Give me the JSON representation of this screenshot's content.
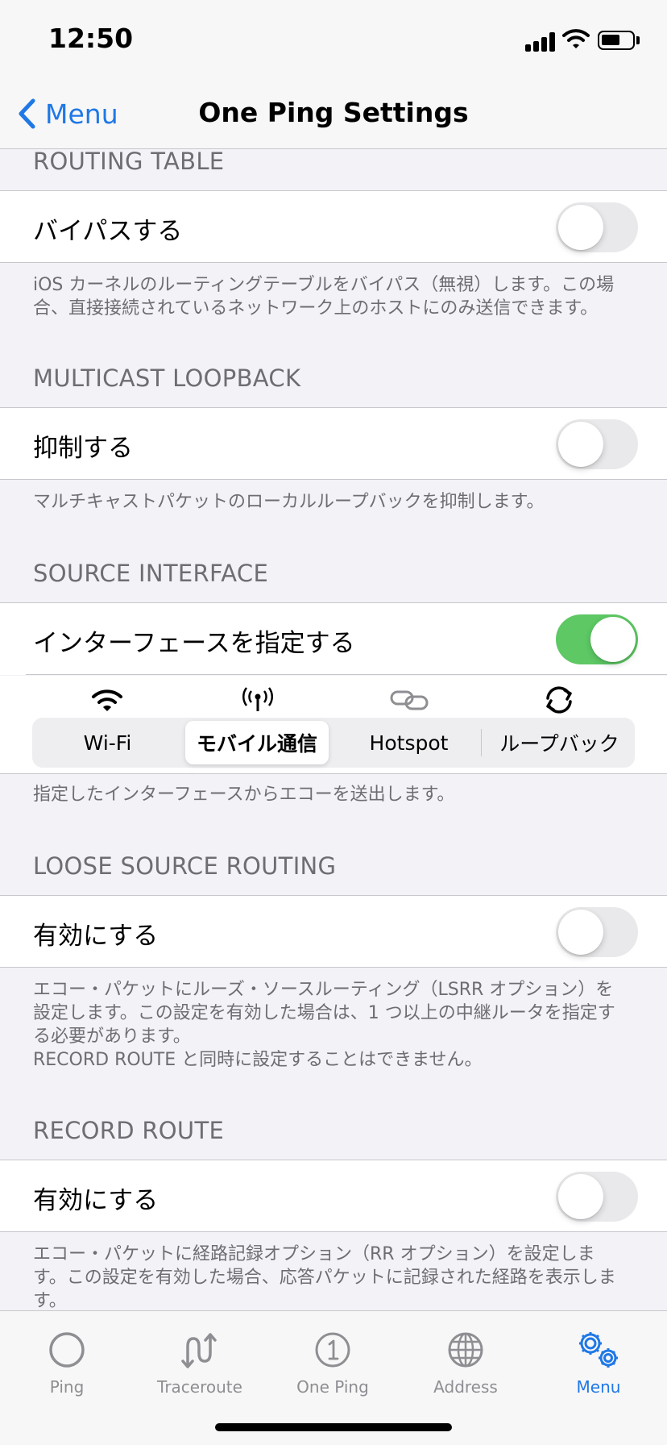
{
  "status_bar": {
    "time": "12:50"
  },
  "nav": {
    "back_label": "Menu",
    "title": "One Ping Settings"
  },
  "routing_table": {
    "header": "ROUTING TABLE",
    "cell_label": "バイパスする",
    "toggle_on": false,
    "footer": "iOS カーネルのルーティングテーブルをバイパス（無視）します。この場\n合、直接接続されているネットワーク上のホストにのみ送信できます。"
  },
  "multicast_loopback": {
    "header": "MULTICAST LOOPBACK",
    "cell_label": "抑制する",
    "toggle_on": false,
    "footer": "マルチキャストパケットのローカルループバックを抑制します。"
  },
  "source_interface": {
    "header": "SOURCE INTERFACE",
    "cell_label": "インターフェースを指定する",
    "toggle_on": true,
    "options": [
      {
        "label": "Wi-Fi",
        "icon": "wifi-icon"
      },
      {
        "label": "モバイル通信",
        "icon": "antenna-icon"
      },
      {
        "label": "Hotspot",
        "icon": "link-icon"
      },
      {
        "label": "ループバック",
        "icon": "loop-icon"
      }
    ],
    "selected_option": "モバイル通信",
    "footer": "指定したインターフェースからエコーを送出します。"
  },
  "loose_source_routing": {
    "header": "LOOSE SOURCE ROUTING",
    "cell_label": "有効にする",
    "toggle_on": false,
    "footer": "エコー・パケットにルーズ・ソースルーティング（LSRR オプション）を\n設定します。この設定を有効した場合は、1 つ以上の中継ルータを指定す\nる必要があります。\nRECORD ROUTE と同時に設定することはできません。"
  },
  "record_route": {
    "header": "RECORD ROUTE",
    "cell_label": "有効にする",
    "toggle_on": false,
    "footer": "エコー・パケットに経路記録オプション（RR オプション）を設定しま\nす。この設定を有効した場合、応答パケットに記録された経路を表示しま\nす。"
  },
  "tab_bar": {
    "tabs": [
      {
        "label": "Ping",
        "icon": "circle-icon",
        "active": false
      },
      {
        "label": "Traceroute",
        "icon": "traceroute-icon",
        "active": false
      },
      {
        "label": "One Ping",
        "icon": "one-ping-icon",
        "active": false
      },
      {
        "label": "Address",
        "icon": "globe-icon",
        "active": false
      },
      {
        "label": "Menu",
        "icon": "gears-icon",
        "active": true
      }
    ]
  },
  "colors": {
    "accent": "#1f78e6",
    "toggle_on": "#5dc864",
    "toggle_off": "#e9e9eb",
    "secondary_text": "#6d6d72",
    "grouped_bg": "#f2f2f7"
  }
}
